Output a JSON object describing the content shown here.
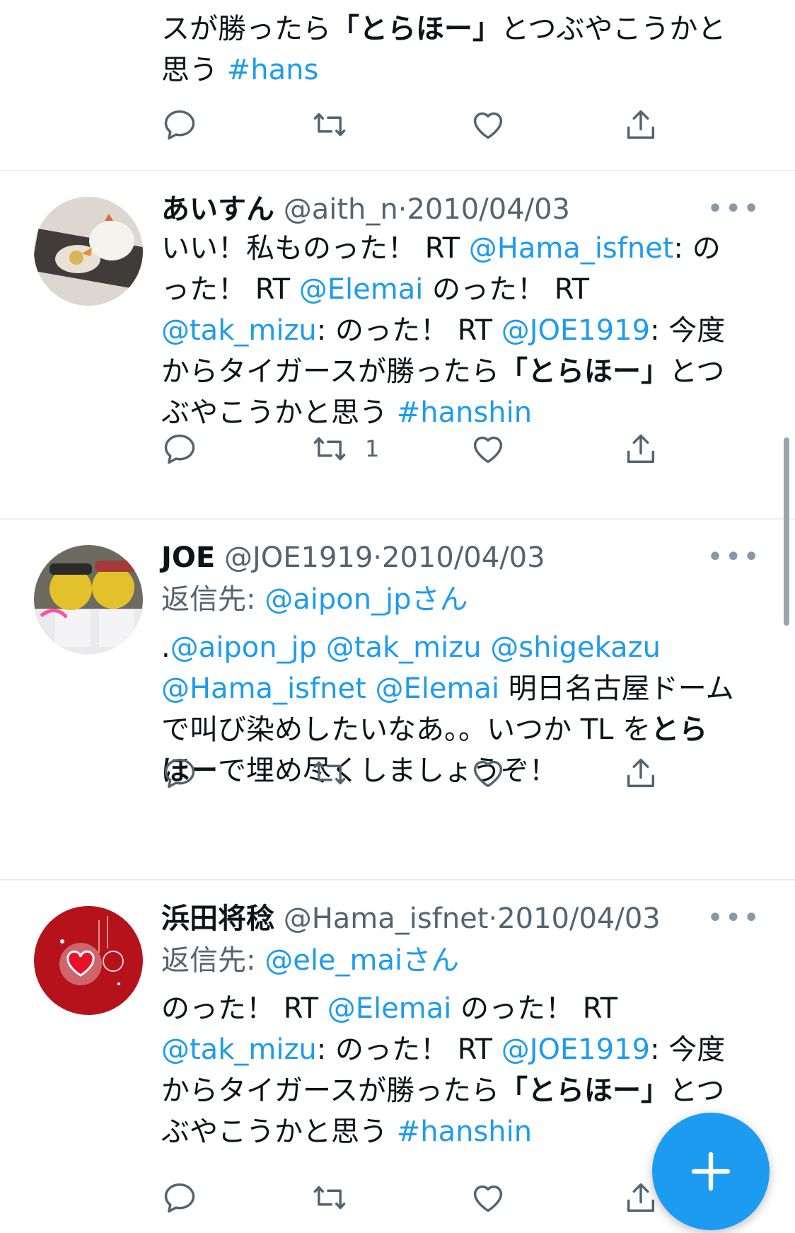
{
  "tweets": [
    {
      "name": "",
      "handle": "",
      "date": "",
      "text": [
        {
          "t": "スが勝ったら"
        },
        {
          "t": "「とらほー」",
          "b": true
        },
        {
          "t": "とつぶやこうかと"
        },
        {
          "br": true
        },
        {
          "t": "思う "
        },
        {
          "t": "#hans",
          "link": true
        }
      ],
      "retweets": ""
    },
    {
      "name": "あいすん",
      "handle": "@aith_n",
      "date": "2010/04/03",
      "text": [
        {
          "t": "いい！私ものった！ RT "
        },
        {
          "t": "@Hama_isfnet",
          "link": true
        },
        {
          "t": ": の"
        },
        {
          "br": true
        },
        {
          "t": "った！ RT "
        },
        {
          "t": "@Elemai",
          "link": true
        },
        {
          "t": " のった！ RT"
        },
        {
          "br": true
        },
        {
          "t": "@tak_mizu",
          "link": true
        },
        {
          "t": ": のった！ RT "
        },
        {
          "t": "@JOE1919",
          "link": true
        },
        {
          "t": ": 今度"
        },
        {
          "br": true
        },
        {
          "t": "からタイガースが勝ったら"
        },
        {
          "t": "「とらほー」",
          "b": true
        },
        {
          "t": "とつ"
        },
        {
          "br": true
        },
        {
          "t": "ぶやこうかと思う "
        },
        {
          "t": "#hanshin",
          "link": true
        }
      ],
      "retweets": "1"
    },
    {
      "name": "JOE",
      "handle": "@JOE1919",
      "date": "2010/04/03",
      "reply_label": "返信先: ",
      "reply_to": "@aipon_jp",
      "reply_suffix": "さん",
      "text": [
        {
          "t": "."
        },
        {
          "t": "@aipon_jp",
          "link": true
        },
        {
          "t": " "
        },
        {
          "t": "@tak_mizu",
          "link": true
        },
        {
          "t": " "
        },
        {
          "t": "@shigekazu",
          "link": true
        },
        {
          "br": true
        },
        {
          "t": "@Hama_isfnet",
          "link": true
        },
        {
          "t": "  "
        },
        {
          "t": "@Elemai",
          "link": true
        },
        {
          "t": " 明日名古屋ドーム"
        },
        {
          "br": true
        },
        {
          "t": "で叫び染めしたいなあ。。いつか TL を"
        },
        {
          "t": "とら",
          "b": true
        },
        {
          "br": true
        },
        {
          "t": "ほー",
          "b": true
        },
        {
          "t": "で埋め尽くしましょうぞ！"
        }
      ],
      "retweets": ""
    },
    {
      "name": "浜田将稔",
      "handle": "@Hama_isfnet",
      "date": "2010/04/03",
      "reply_label": "返信先: ",
      "reply_to": "@ele_mai",
      "reply_suffix": "さん",
      "text": [
        {
          "t": "のった！ RT "
        },
        {
          "t": "@Elemai",
          "link": true
        },
        {
          "t": " のった！ RT"
        },
        {
          "br": true
        },
        {
          "t": "@tak_mizu",
          "link": true
        },
        {
          "t": ": のった！ RT "
        },
        {
          "t": "@JOE1919",
          "link": true
        },
        {
          "t": ": 今度"
        },
        {
          "br": true
        },
        {
          "t": "からタイガースが勝ったら"
        },
        {
          "t": "「とらほー」",
          "b": true
        },
        {
          "t": "とつ"
        },
        {
          "br": true
        },
        {
          "t": "ぶやこうかと思う "
        },
        {
          "t": "#hanshin",
          "link": true
        }
      ],
      "retweets": ""
    }
  ],
  "ui": {
    "more_label": "•••",
    "dot": "·",
    "fab_icon": "plus-icon",
    "accent": "#1d9bf0"
  }
}
